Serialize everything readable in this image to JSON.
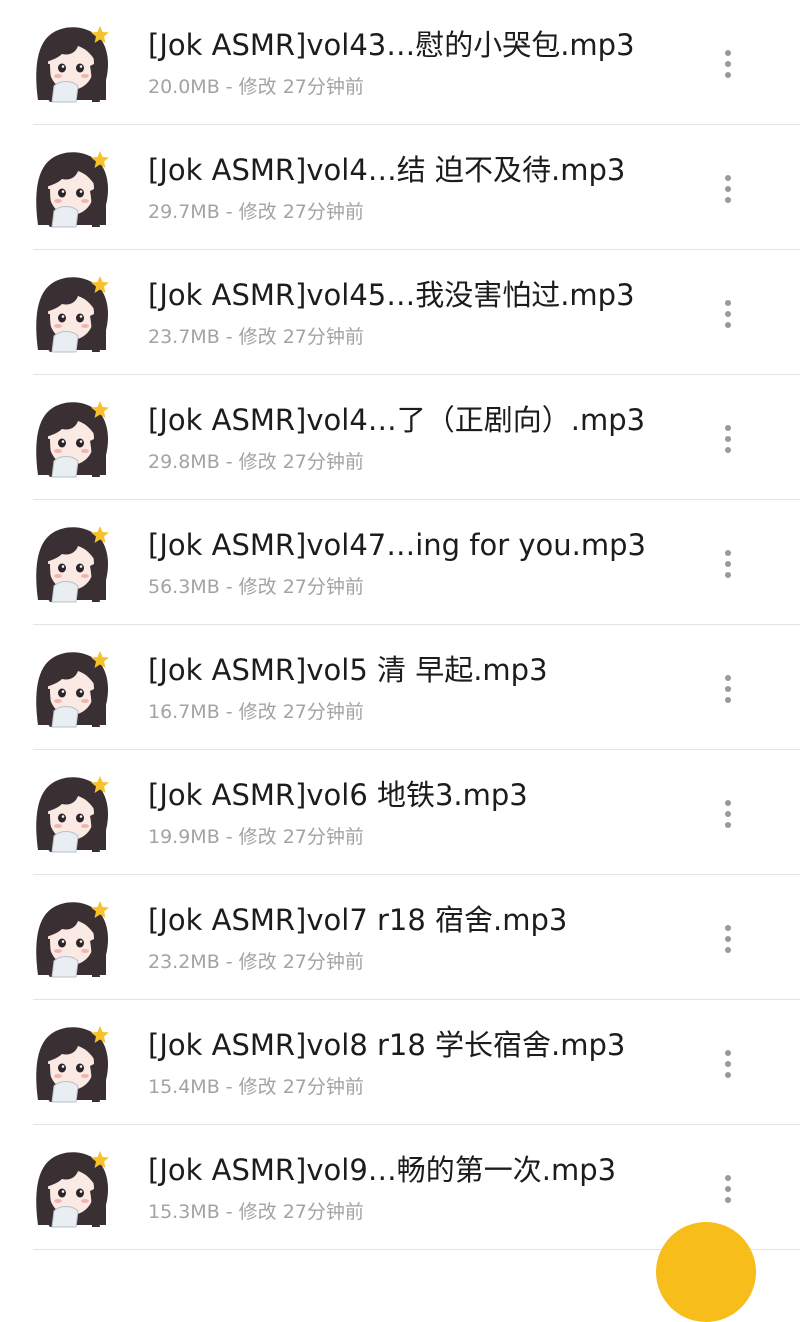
{
  "colors": {
    "title": "#1c1c1c",
    "meta": "#a3a3a3",
    "divider": "#e3e3e3",
    "fab": "#f7bd1b"
  },
  "files": [
    {
      "name": "[Jok ASMR]vol43…慰的小哭包.mp3",
      "size": "20.0MB",
      "modified": "修改 27分钟前",
      "icon": "anime-girl-thumbnail"
    },
    {
      "name": "[Jok ASMR]vol4…结 迫不及待.mp3",
      "size": "29.7MB",
      "modified": "修改 27分钟前",
      "icon": "anime-girl-thumbnail"
    },
    {
      "name": "[Jok ASMR]vol45…我没害怕过.mp3",
      "size": "23.7MB",
      "modified": "修改 27分钟前",
      "icon": "anime-girl-thumbnail"
    },
    {
      "name": "[Jok ASMR]vol4…了（正剧向）.mp3",
      "size": "29.8MB",
      "modified": "修改 27分钟前",
      "icon": "anime-girl-thumbnail"
    },
    {
      "name": "[Jok ASMR]vol47…ing for you.mp3",
      "size": "56.3MB",
      "modified": "修改 27分钟前",
      "icon": "anime-girl-thumbnail"
    },
    {
      "name": "[Jok ASMR]vol5 清 早起.mp3",
      "size": "16.7MB",
      "modified": "修改 27分钟前",
      "icon": "anime-girl-thumbnail"
    },
    {
      "name": "[Jok ASMR]vol6 地铁3.mp3",
      "size": "19.9MB",
      "modified": "修改 27分钟前",
      "icon": "anime-girl-thumbnail"
    },
    {
      "name": "[Jok ASMR]vol7 r18 宿舍.mp3",
      "size": "23.2MB",
      "modified": "修改 27分钟前",
      "icon": "anime-girl-thumbnail"
    },
    {
      "name": "[Jok ASMR]vol8 r18 学长宿舍.mp3",
      "size": "15.4MB",
      "modified": "修改 27分钟前",
      "icon": "anime-girl-thumbnail"
    },
    {
      "name": "[Jok ASMR]vol9…畅的第一次.mp3",
      "size": "15.3MB",
      "modified": "修改 27分钟前",
      "icon": "anime-girl-thumbnail"
    }
  ],
  "meta_separator": " - ",
  "more_icon": "more-vertical-icon",
  "fab_icon": "fab-button"
}
